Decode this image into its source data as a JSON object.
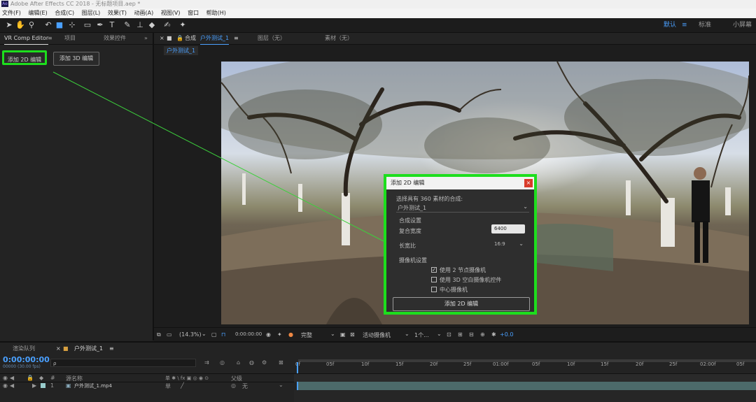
{
  "window": {
    "title": "Adobe After Effects CC 2018 - 无标题项目.aep *",
    "logo": "Ae"
  },
  "menu": [
    "文件(F)",
    "编辑(E)",
    "合成(C)",
    "图层(L)",
    "效果(T)",
    "动画(A)",
    "视图(V)",
    "窗口",
    "帮助(H)"
  ],
  "workspaces": {
    "default": "默认",
    "standard": "标准",
    "small": "小屏幕"
  },
  "left_panel": {
    "tabs": [
      "VR Comp Editor",
      "项目",
      "效果控件"
    ],
    "btn_2d": "添加 2D 编辑",
    "btn_3d": "添加 3D 编辑",
    "highlight_color": "#1dde1d"
  },
  "comp_panel": {
    "tab_label": "合成",
    "comp_name": "户外测试_1",
    "layer_tab": "图层（无）",
    "footage_tab": "素材（无）",
    "breadcrumb": "户外测试_1"
  },
  "dialog": {
    "title": "添加 2D 编辑",
    "select_label": "选择具有 360 素材的合成:",
    "select_value": "户外测试_1",
    "comp_settings": "合成设置",
    "width_label": "复合宽度",
    "width_value": "6400",
    "aspect_label": "长宽比",
    "aspect_value": "16:9",
    "camera_settings": "摄像机设置",
    "opt1": "使用 2 节点摄像机",
    "opt1_checked": true,
    "opt2": "使用 3D 空白摄像机控件",
    "opt3": "中心摄像机",
    "ok_button": "添加 2D 编辑"
  },
  "viewer_bar": {
    "zoom": "(14.3%)",
    "time": "0:00:00:00",
    "resolution": "完整",
    "camera": "活动摄像机",
    "view": "1个...",
    "exposure": "+0.0"
  },
  "timeline": {
    "render_queue_tab": "渲染队列",
    "comp_tab": "户外测试_1",
    "timecode": "0:00:00:00",
    "timecode_sub": "00000 (30.00 fps)",
    "search_placeholder": "ρ",
    "col_num": "#",
    "col_name": "源名称",
    "col_switches": "单 ✱ \\ fx ▣ ◎ ◉ ⊙",
    "col_parent": "父级",
    "ruler": [
      "0f",
      "05f",
      "10f",
      "15f",
      "20f",
      "25f",
      "01:00f",
      "05f",
      "10f",
      "15f",
      "20f",
      "25f",
      "02:00f",
      "05f"
    ],
    "layer": {
      "index": "1",
      "name": "户外测试_1.mp4",
      "parent": "无"
    }
  }
}
